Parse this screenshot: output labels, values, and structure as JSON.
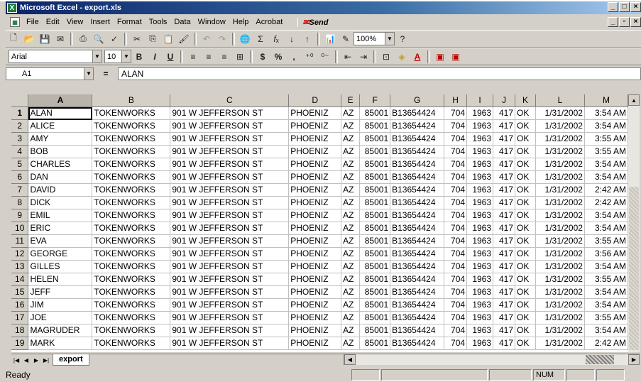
{
  "window": {
    "title": "Microsoft Excel - export.xls",
    "app_icon": "X",
    "buttons": [
      "_",
      "□",
      "×"
    ]
  },
  "menu": {
    "items": [
      "File",
      "Edit",
      "View",
      "Insert",
      "Format",
      "Tools",
      "Data",
      "Window",
      "Help",
      "Acrobat"
    ],
    "send_label": "Send",
    "doc_buttons": [
      "_",
      "▫",
      "×"
    ]
  },
  "toolbar": {
    "zoom": "100%"
  },
  "format_toolbar": {
    "font": "Arial",
    "size": "10",
    "bold": "B",
    "italic": "I",
    "underline": "U",
    "currency": "$",
    "percent": "%",
    "comma": ","
  },
  "formula_bar": {
    "cell_ref": "A1",
    "equals": "=",
    "content": "ALAN"
  },
  "sheet": {
    "columns": [
      "A",
      "B",
      "C",
      "D",
      "E",
      "F",
      "G",
      "H",
      "I",
      "J",
      "K",
      "L",
      "M"
    ],
    "rows": [
      [
        "ALAN",
        "TOKENWORKS",
        "901 W JEFFERSON ST",
        "PHOENIZ",
        "AZ",
        "85001",
        "B13654424",
        "704",
        "1963",
        "417",
        "OK",
        "1/31/2002",
        "3:54 AM"
      ],
      [
        "ALICE",
        "TOKENWORKS",
        "901 W JEFFERSON ST",
        "PHOENIZ",
        "AZ",
        "85001",
        "B13654424",
        "704",
        "1963",
        "417",
        "OK",
        "1/31/2002",
        "3:54 AM"
      ],
      [
        "AMY",
        "TOKENWORKS",
        "901 W JEFFERSON ST",
        "PHOENIZ",
        "AZ",
        "85001",
        "B13654424",
        "704",
        "1963",
        "417",
        "OK",
        "1/31/2002",
        "3:55 AM"
      ],
      [
        "BOB",
        "TOKENWORKS",
        "901 W JEFFERSON ST",
        "PHOENIZ",
        "AZ",
        "85001",
        "B13654424",
        "704",
        "1963",
        "417",
        "OK",
        "1/31/2002",
        "3:55 AM"
      ],
      [
        "CHARLES",
        "TOKENWORKS",
        "901 W JEFFERSON ST",
        "PHOENIZ",
        "AZ",
        "85001",
        "B13654424",
        "704",
        "1963",
        "417",
        "OK",
        "1/31/2002",
        "3:54 AM"
      ],
      [
        "DAN",
        "TOKENWORKS",
        "901 W JEFFERSON ST",
        "PHOENIZ",
        "AZ",
        "85001",
        "B13654424",
        "704",
        "1963",
        "417",
        "OK",
        "1/31/2002",
        "3:54 AM"
      ],
      [
        "DAVID",
        "TOKENWORKS",
        "901 W JEFFERSON ST",
        "PHOENIZ",
        "AZ",
        "85001",
        "B13654424",
        "704",
        "1963",
        "417",
        "OK",
        "1/31/2002",
        "2:42 AM"
      ],
      [
        "DICK",
        "TOKENWORKS",
        "901 W JEFFERSON ST",
        "PHOENIZ",
        "AZ",
        "85001",
        "B13654424",
        "704",
        "1963",
        "417",
        "OK",
        "1/31/2002",
        "2:42 AM"
      ],
      [
        "EMIL",
        "TOKENWORKS",
        "901 W JEFFERSON ST",
        "PHOENIZ",
        "AZ",
        "85001",
        "B13654424",
        "704",
        "1963",
        "417",
        "OK",
        "1/31/2002",
        "3:54 AM"
      ],
      [
        "ERIC",
        "TOKENWORKS",
        "901 W JEFFERSON ST",
        "PHOENIZ",
        "AZ",
        "85001",
        "B13654424",
        "704",
        "1963",
        "417",
        "OK",
        "1/31/2002",
        "3:54 AM"
      ],
      [
        "EVA",
        "TOKENWORKS",
        "901 W JEFFERSON ST",
        "PHOENIZ",
        "AZ",
        "85001",
        "B13654424",
        "704",
        "1963",
        "417",
        "OK",
        "1/31/2002",
        "3:55 AM"
      ],
      [
        "GEORGE",
        "TOKENWORKS",
        "901 W JEFFERSON ST",
        "PHOENIZ",
        "AZ",
        "85001",
        "B13654424",
        "704",
        "1963",
        "417",
        "OK",
        "1/31/2002",
        "3:56 AM"
      ],
      [
        "GILLES",
        "TOKENWORKS",
        "901 W JEFFERSON ST",
        "PHOENIZ",
        "AZ",
        "85001",
        "B13654424",
        "704",
        "1963",
        "417",
        "OK",
        "1/31/2002",
        "3:54 AM"
      ],
      [
        "HELEN",
        "TOKENWORKS",
        "901 W JEFFERSON ST",
        "PHOENIZ",
        "AZ",
        "85001",
        "B13654424",
        "704",
        "1963",
        "417",
        "OK",
        "1/31/2002",
        "3:55 AM"
      ],
      [
        "JEFF",
        "TOKENWORKS",
        "901 W JEFFERSON ST",
        "PHOENIZ",
        "AZ",
        "85001",
        "B13654424",
        "704",
        "1963",
        "417",
        "OK",
        "1/31/2002",
        "3:54 AM"
      ],
      [
        "JIM",
        "TOKENWORKS",
        "901 W JEFFERSON ST",
        "PHOENIZ",
        "AZ",
        "85001",
        "B13654424",
        "704",
        "1963",
        "417",
        "OK",
        "1/31/2002",
        "3:54 AM"
      ],
      [
        "JOE",
        "TOKENWORKS",
        "901 W JEFFERSON ST",
        "PHOENIZ",
        "AZ",
        "85001",
        "B13654424",
        "704",
        "1963",
        "417",
        "OK",
        "1/31/2002",
        "3:55 AM"
      ],
      [
        "MAGRUDER",
        "TOKENWORKS",
        "901 W JEFFERSON ST",
        "PHOENIZ",
        "AZ",
        "85001",
        "B13654424",
        "704",
        "1963",
        "417",
        "OK",
        "1/31/2002",
        "3:54 AM"
      ],
      [
        "MARK",
        "TOKENWORKS",
        "901 W JEFFERSON ST",
        "PHOENIZ",
        "AZ",
        "85001",
        "B13654424",
        "704",
        "1963",
        "417",
        "OK",
        "1/31/2002",
        "2:42 AM"
      ]
    ],
    "numeric_columns": [
      5,
      7,
      8,
      9,
      11,
      12
    ]
  },
  "tabs": {
    "sheet_name": "export"
  },
  "status": {
    "text": "Ready",
    "num": "NUM"
  }
}
